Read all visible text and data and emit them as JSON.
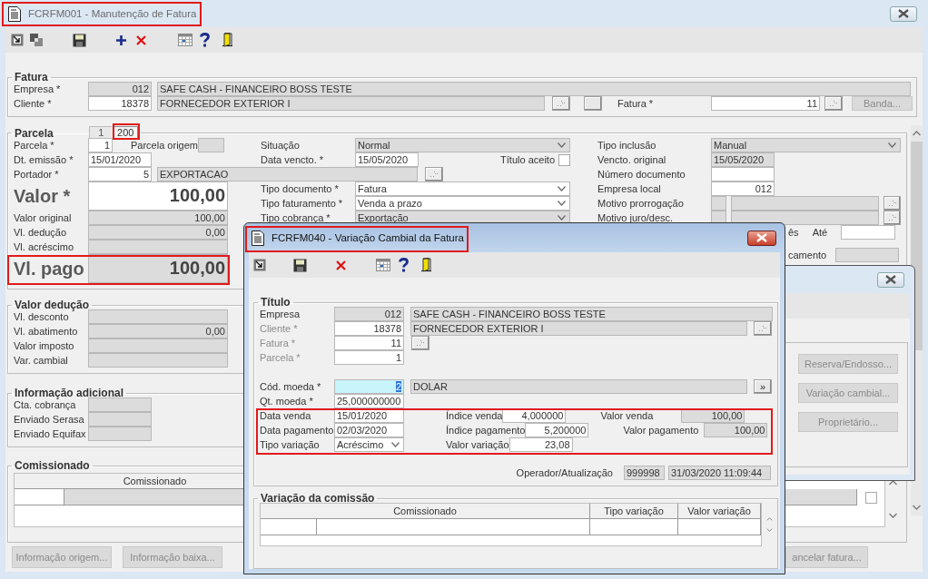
{
  "main_window": {
    "title": "FCRFM001 - Manutenção de Fatura",
    "fatura": {
      "legend": "Fatura",
      "empresa": {
        "label": "Empresa *",
        "code": "012",
        "name": "SAFE CASH - FINANCEIRO BOSS TESTE"
      },
      "cliente": {
        "label": "Cliente *",
        "code": "18378",
        "name": "FORNECEDOR EXTERIOR I"
      },
      "fatura": {
        "label": "Fatura *",
        "value": "11"
      },
      "banda_button": {
        "label": "Banda...",
        "disabled": true
      }
    },
    "parcela": {
      "legend": "Parcela",
      "tabs": [
        {
          "label": "1",
          "selected": false
        },
        {
          "label": "200",
          "selected": true
        }
      ],
      "parcela": {
        "label": "Parcela *",
        "value": "1"
      },
      "parcela_origem": {
        "label": "Parcela origem"
      },
      "situacao": {
        "label": "Situação",
        "value": "Normal"
      },
      "tipo_inclusao": {
        "label": "Tipo inclusão",
        "value": "Manual"
      },
      "dt_emissao": {
        "label": "Dt. emissão *",
        "value": "15/01/2020"
      },
      "data_vencto": {
        "label": "Data vencto. *",
        "value": "15/05/2020"
      },
      "titulo_aceito": {
        "label": "Título aceito",
        "checked": false
      },
      "vencto_original": {
        "label": "Vencto. original",
        "value": "15/05/2020"
      },
      "portador": {
        "label": "Portador *",
        "code": "5",
        "name": "EXPORTACAO"
      },
      "numero_documento": {
        "label": "Número documento"
      },
      "valor": {
        "label": "Valor *",
        "value": "100,00"
      },
      "left_fields": [
        {
          "label": "Valor original",
          "value": "100,00"
        },
        {
          "label": "Vl. dedução",
          "value": "0,00"
        },
        {
          "label": "Vl. acréscimo"
        }
      ],
      "vl_pago": {
        "label": "Vl. pago",
        "value": "100,00"
      },
      "mid_fields": [
        {
          "label": "Tipo documento *",
          "value": "Fatura",
          "disabled": false
        },
        {
          "label": "Tipo faturamento *",
          "value": "Venda a prazo",
          "disabled": false
        },
        {
          "label": "Tipo cobrança *",
          "value": "Exportação",
          "disabled": true
        }
      ],
      "empresa_local": {
        "label": "Empresa local",
        "value": "012"
      },
      "motivos": [
        {
          "label": "Motivo prorrogação"
        },
        {
          "label": "Motivo juro/desc."
        }
      ],
      "mes_label": "ês",
      "ate_label": "Até",
      "camento_label": "camento"
    },
    "valor_deducao": {
      "legend": "Valor dedução",
      "fields": [
        {
          "label": "Vl. desconto"
        },
        {
          "label": "Vl. abatimento",
          "value": "0,00"
        },
        {
          "label": "Valor imposto"
        },
        {
          "label": "Var. cambial"
        }
      ]
    },
    "informacao_adicional": {
      "legend": "Informação adicional",
      "fields": [
        {
          "label": "Cta. cobrança"
        },
        {
          "label": "Enviado Serasa"
        },
        {
          "label": "Enviado Equifax"
        }
      ]
    },
    "comissionado": {
      "legend": "Comissionado",
      "column": "Comissionado",
      "checked": false
    },
    "buttons": [
      {
        "label": "Informação origem...",
        "disabled": true
      },
      {
        "label": "Informação baixa...",
        "disabled": true
      }
    ],
    "cancel_button": {
      "label": "ancelar fatura...",
      "disabled": true
    }
  },
  "options_window": {
    "buttons": [
      {
        "label": "Reserva/Endosso...",
        "disabled": true
      },
      {
        "label": "Variação cambial...",
        "disabled": true
      },
      {
        "label": "Proprietário...",
        "disabled": true
      }
    ]
  },
  "dialog": {
    "title": "FCRFM040 - Variação Cambial da Fatura",
    "titulo": {
      "legend": "Título",
      "empresa": {
        "label": "Empresa",
        "code": "012",
        "name": "SAFE CASH - FINANCEIRO BOSS TESTE",
        "disabled": false
      },
      "cliente": {
        "label": "Cliente *",
        "code": "18378",
        "name": "FORNECEDOR EXTERIOR I",
        "disabled": true
      },
      "fatura": {
        "label": "Fatura *",
        "value": "11",
        "disabled": true
      },
      "parcela": {
        "label": "Parcela *",
        "value": "1",
        "disabled": true
      },
      "moeda": {
        "label": "Cód. moeda *",
        "code": "2",
        "name": "DOLAR",
        "lookup": "»"
      },
      "qt_moeda": {
        "label": "Qt. moeda *",
        "value": "25,000000000"
      },
      "variacao_rows": [
        {
          "kind": "date",
          "label": "Data venda",
          "value": "15/01/2020",
          "index_label": "Índice venda",
          "index_value": "4,000000",
          "amount_label": "Valor venda",
          "amount_value": "100,00"
        },
        {
          "kind": "date",
          "label": "Data pagamento",
          "value": "02/03/2020",
          "index_label": "Índice pagamento",
          "index_value": "5,200000",
          "amount_label": "Valor pagamento",
          "amount_value": "100,00"
        },
        {
          "kind": "select",
          "label": "Tipo variação",
          "value": "Acréscimo",
          "index_label": "Valor variação",
          "index_value": "23,08"
        }
      ],
      "operador": {
        "label": "Operador/Atualização",
        "code": "999998",
        "timestamp": "31/03/2020 11:09:44"
      }
    },
    "comissao": {
      "legend": "Variação da comissão",
      "columns": [
        "Comissionado",
        "Tipo variação",
        "Valor variação"
      ]
    }
  }
}
